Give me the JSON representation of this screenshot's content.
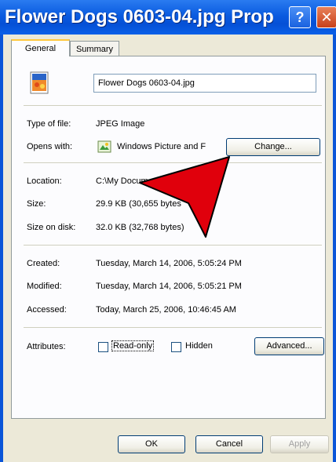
{
  "window": {
    "title": "Flower Dogs 0603-04.jpg Prop...",
    "help_glyph": "?",
    "close_glyph": "✕"
  },
  "tabs": [
    {
      "label": "General",
      "active": true
    },
    {
      "label": "Summary",
      "active": false
    }
  ],
  "general": {
    "filename": "Flower Dogs 0603-04.jpg",
    "type_label": "Type of file:",
    "type_value": "JPEG Image",
    "opens_label": "Opens with:",
    "opens_value": "Windows Picture and F",
    "change_button": "Change...",
    "location_label": "Location:",
    "location_value": "C:\\My Docum",
    "size_label": "Size:",
    "size_value": "29.9 KB (30,655 bytes",
    "size_on_disk_label": "Size on disk:",
    "size_on_disk_value": "32.0 KB (32,768 bytes)",
    "created_label": "Created:",
    "created_value": "Tuesday, March 14, 2006, 5:05:24 PM",
    "modified_label": "Modified:",
    "modified_value": "Tuesday, March 14, 2006, 5:05:21 PM",
    "accessed_label": "Accessed:",
    "accessed_value": "Today, March 25, 2006, 10:46:45 AM",
    "attributes_label": "Attributes:",
    "readonly_label": "Read-only",
    "readonly_checked": false,
    "hidden_label": "Hidden",
    "hidden_checked": false,
    "advanced_button": "Advanced..."
  },
  "footer": {
    "ok": "OK",
    "cancel": "Cancel",
    "apply": "Apply"
  },
  "colors": {
    "titlebar": "#0a5be0",
    "dialog_bg": "#ece9d8",
    "annotation_arrow": "#e0000c"
  },
  "icons": {
    "file": "image-file-icon",
    "app": "picture-viewer-icon",
    "annotation": "red-pointer-arrow"
  }
}
